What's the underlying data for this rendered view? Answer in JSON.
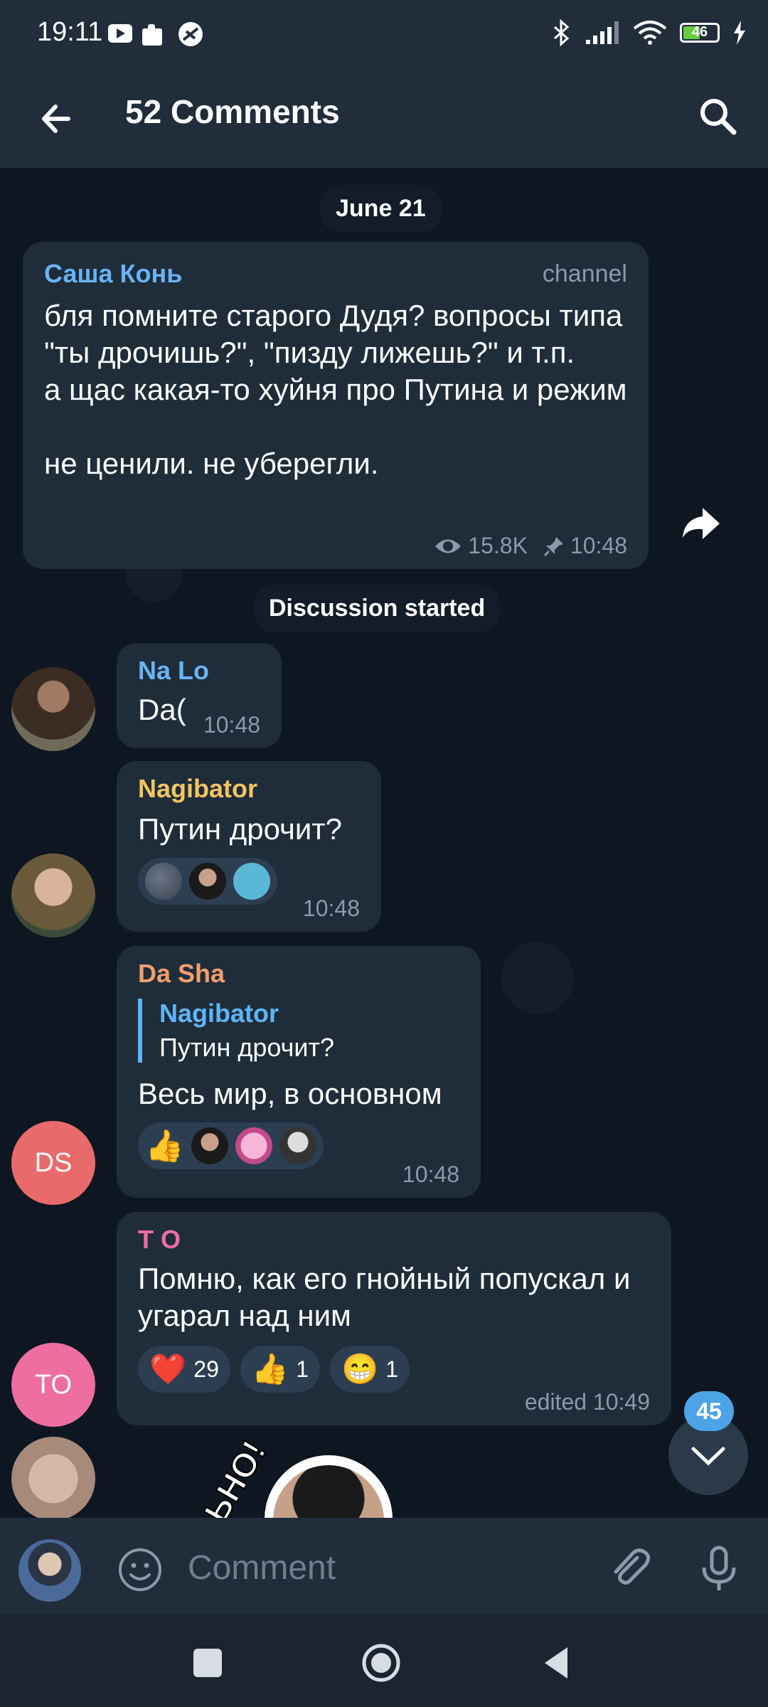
{
  "status_bar": {
    "time": "19:11",
    "battery": "46"
  },
  "header": {
    "title": "52 Comments"
  },
  "date_pill": "June 21",
  "channel_post": {
    "author": "Саша Конь",
    "tag": "channel",
    "text": "бля помните старого Дудя? вопросы типа \"ты дрочишь?\", \"пизду лижешь?\" и т.п.\nа щас какая-то хуйня про Путина и режим\n\nне ценили. не уберегли.",
    "views": "15.8K",
    "time": "10:48"
  },
  "discussion_pill": "Discussion started",
  "messages": [
    {
      "author": "Na Lo",
      "text": "Da(",
      "time": "10:48",
      "author_color": "#6ab3f3"
    },
    {
      "author": "Nagibator",
      "text": "Путин дрочит?",
      "time": "10:48",
      "author_color": "#f2c560"
    },
    {
      "author": "Da Sha",
      "reply_to_author": "Nagibator",
      "reply_to_text": "Путин дрочит?",
      "text": "Весь мир, в основном",
      "time": "10:48",
      "author_color": "#f29e6c",
      "avatar_initials": "DS"
    },
    {
      "author": "T O",
      "text": "Помню, как его гнойный попускал и угарал над ним",
      "time": "edited 10:49",
      "author_color": "#ee6ea0",
      "avatar_initials": "TO",
      "reactions": [
        {
          "emoji": "❤️",
          "count": "29"
        },
        {
          "emoji": "👍",
          "count": "1"
        },
        {
          "emoji": "😁",
          "count": "1"
        }
      ]
    }
  ],
  "sticker_text": "ЬНО!",
  "unread_count": "45",
  "input": {
    "placeholder": "Comment"
  }
}
